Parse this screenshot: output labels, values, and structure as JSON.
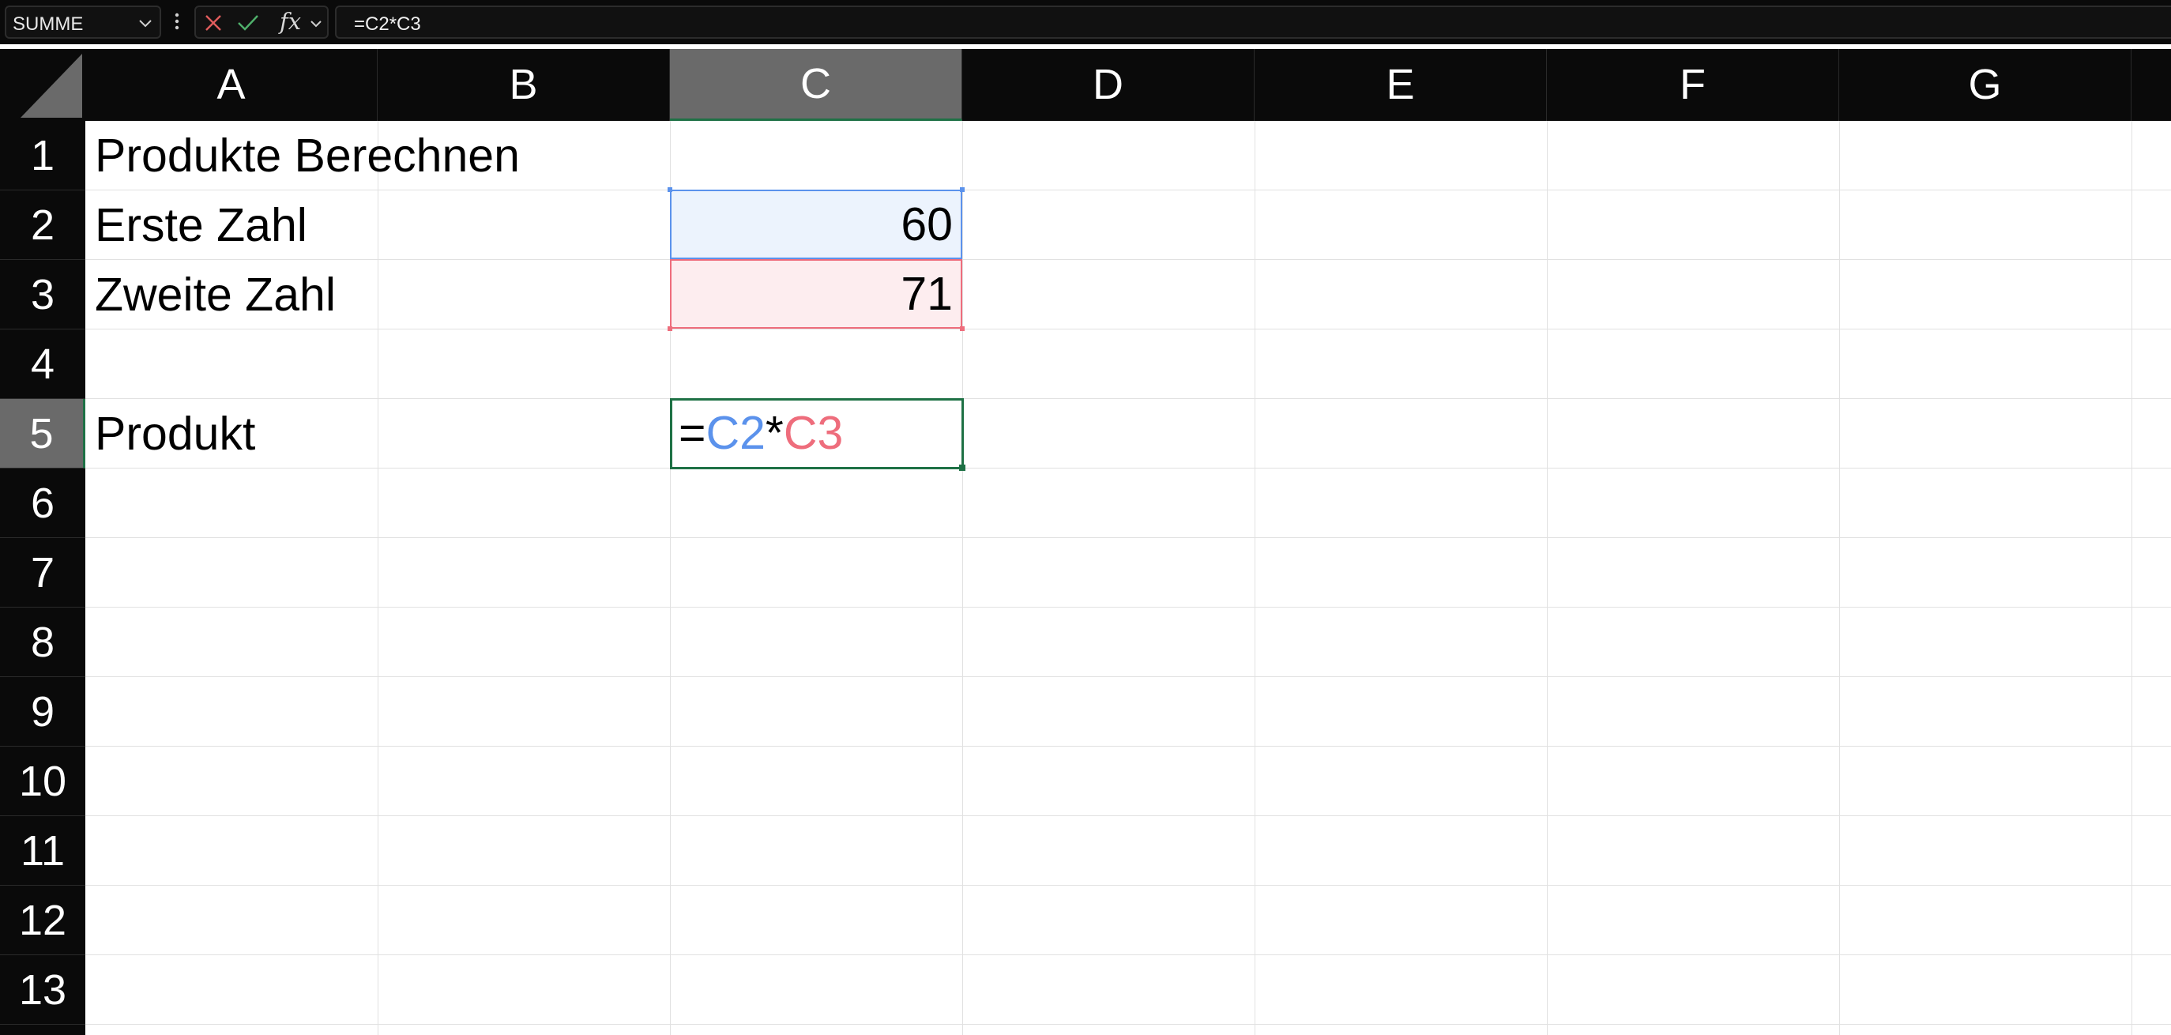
{
  "formula_bar": {
    "name_box": "SUMME",
    "formula": "=C2*C3",
    "fx_label": "fx"
  },
  "columns": [
    "A",
    "B",
    "C",
    "D",
    "E",
    "F",
    "G"
  ],
  "selected_column": "C",
  "rows": [
    "1",
    "2",
    "3",
    "4",
    "5",
    "6",
    "7",
    "8",
    "9",
    "10",
    "11",
    "12",
    "13"
  ],
  "selected_row": "5",
  "cells": {
    "A1": "Produkte Berechnen",
    "A2": "Erste Zahl",
    "A3": "Zweite Zahl",
    "A5": "Produkt",
    "C2": "60",
    "C3": "71"
  },
  "editing_cell": {
    "ref": "C5",
    "prefix": "=",
    "ref1": "C2",
    "operator": "*",
    "ref2": "C3"
  },
  "colors": {
    "selection_green": "#1e7145",
    "ref1_blue": "#5b92ec",
    "ref2_red": "#ee6d7c",
    "header_bg": "#0a0a0a",
    "header_selected_bg": "#6a6a6a"
  }
}
